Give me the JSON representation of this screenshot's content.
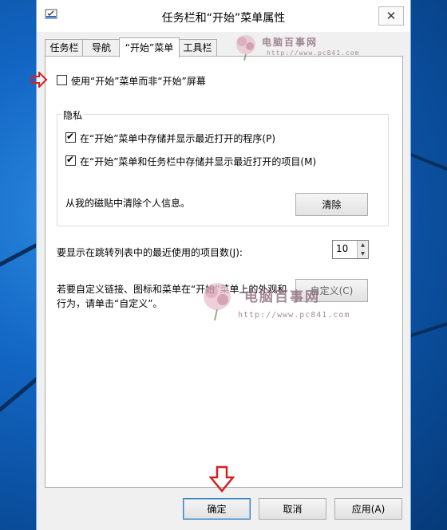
{
  "window": {
    "title": "任务栏和“开始”菜单属性",
    "close_glyph": "✕"
  },
  "tabs": [
    {
      "label": "任务栏"
    },
    {
      "label": "导航"
    },
    {
      "label": "“开始”菜单",
      "active": true
    },
    {
      "label": "工具栏"
    }
  ],
  "panel": {
    "use_start_menu": {
      "label": "使用“开始”菜单而非“开始”屏幕",
      "checked": false
    },
    "privacy": {
      "title": "隐私",
      "store_programs": {
        "label": "在“开始”菜单中存储并显示最近打开的程序(P)",
        "checked": true
      },
      "store_items": {
        "label": "在“开始”菜单和任务栏中存储并显示最近打开的项目(M)",
        "checked": true
      },
      "clear_text": "从我的磁贴中清除个人信息。",
      "clear_button": "清除"
    },
    "jumplist": {
      "label": "要显示在跳转列表中的最近使用的项目数(J):",
      "value": "10"
    },
    "customize": {
      "text_line1": "若要自定义链接、图标和菜单在“开始”菜单上的外观和",
      "text_line2": "行为，请单击“自定义”。",
      "button": "自定义(C)"
    }
  },
  "footer": {
    "ok": "确定",
    "cancel": "取消",
    "apply": "应用(A)"
  },
  "watermark": {
    "brand": "电脑百事网",
    "url": "http://www.pc841.com",
    "color": "#8d6b7a"
  },
  "colors": {
    "annotation_arrow": "#d62020",
    "desktop": "#0d63b8"
  }
}
